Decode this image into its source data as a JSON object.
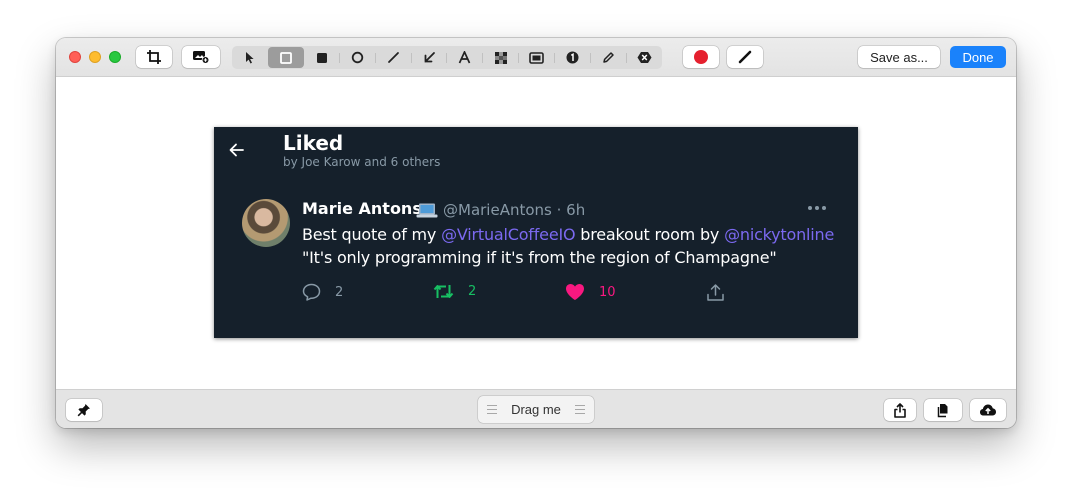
{
  "toolbar": {
    "crop_icon": "crop-icon",
    "add_image_icon": "add-image-icon",
    "tools": [
      {
        "name": "arrow-pointer-icon",
        "selected": false
      },
      {
        "name": "rectangle-outline-icon",
        "selected": true
      },
      {
        "name": "rectangle-filled-icon",
        "selected": false
      },
      {
        "name": "circle-icon",
        "selected": false
      },
      {
        "name": "line-icon",
        "selected": false
      },
      {
        "name": "arrow-icon",
        "selected": false
      },
      {
        "name": "text-icon",
        "selected": false
      },
      {
        "name": "pixelate-icon",
        "selected": false
      },
      {
        "name": "highlight-icon",
        "selected": false
      },
      {
        "name": "counter-icon",
        "selected": false
      },
      {
        "name": "pencil-icon",
        "selected": false
      },
      {
        "name": "eraser-icon",
        "selected": false
      }
    ],
    "color": "#e5202e",
    "save_as_label": "Save as...",
    "done_label": "Done"
  },
  "tweet": {
    "header_title": "Liked",
    "header_subtitle": "by Joe Karow and 6 others",
    "author_name": "Marie Antons",
    "author_emoji_icon": "laptop-icon",
    "handle_time": "@MarieAntons · 6h",
    "line1_prefix": "Best quote of my ",
    "mention1": "@VirtualCoffeeIO",
    "line1_middle": " breakout room by ",
    "mention2": "@nickytonline",
    "line2": "\"It's only programming if it's from the region of Champagne\"",
    "replies": "2",
    "retweets": "2",
    "likes": "10",
    "colors": {
      "background": "#15202b",
      "mention": "#7b69f0",
      "retweet": "#17bf63",
      "like": "#f91880",
      "muted": "#8899a6"
    }
  },
  "bottombar": {
    "pin_icon": "pin-icon",
    "drag_label": "Drag me",
    "share_icon": "share-icon",
    "copy_icon": "copy-icon",
    "upload_icon": "cloud-upload-icon"
  }
}
